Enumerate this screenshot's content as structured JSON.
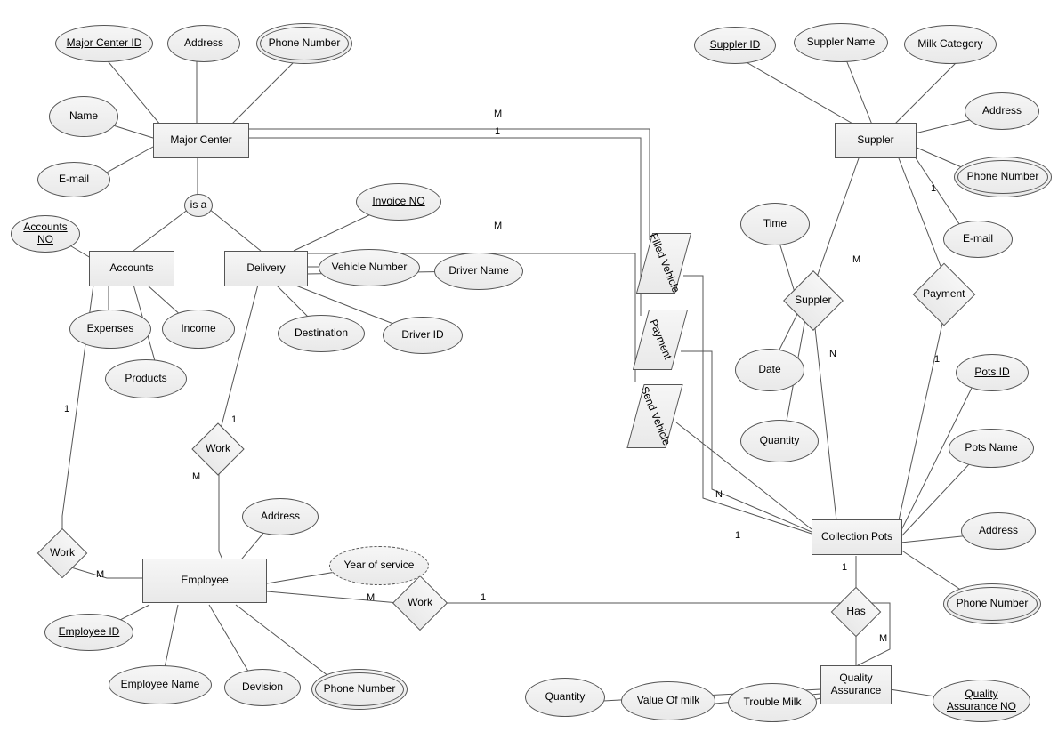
{
  "entities": {
    "major_center": "Major Center",
    "accounts": "Accounts",
    "delivery": "Delivery",
    "employee": "Employee",
    "supplier": "Suppler",
    "collection_pots": "Collection Pots",
    "quality_assurance": "Quality\nAssurance"
  },
  "attributes": {
    "major_center_id": "Major Center ID",
    "mc_address": "Address",
    "mc_phone": "Phone Number",
    "mc_name": "Name",
    "mc_email": "E-mail",
    "accounts_no": "Accounts\nNO",
    "acc_expenses": "Expenses",
    "acc_income": "Income",
    "acc_products": "Products",
    "invoice_no": "Invoice NO",
    "vehicle_number": "Vehicle Number",
    "driver_name": "Driver Name",
    "destination": "Destination",
    "driver_id": "Driver ID",
    "emp_address": "Address",
    "year_of_service": "Year of service",
    "employee_id": "Employee ID",
    "employee_name": "Employee Name",
    "devision": "Devision",
    "emp_phone": "Phone Number",
    "supplier_id": "Suppler ID",
    "supplier_name": "Suppler Name",
    "milk_category": "Milk Category",
    "sup_address": "Address",
    "sup_phone": "Phone Number",
    "sup_email": "E-mail",
    "time": "Time",
    "date": "Date",
    "quantity": "Quantity",
    "pots_id": "Pots ID",
    "pots_name": "Pots Name",
    "cp_address": "Address",
    "cp_phone": "Phone Number",
    "qa_quantity": "Quantity",
    "value_of_milk": "Value Of milk",
    "trouble_milk": "Trouble Milk",
    "qa_no": "Quality\nAssurance NO"
  },
  "relations": {
    "isa": "is a",
    "work1": "Work",
    "work2": "Work",
    "work3": "Work",
    "filled_vehicle": "Filled Vehicle",
    "payment_pgram": "Payment",
    "send_vehicle": "Send Vehicle",
    "supplier_rel": "Suppler",
    "payment_diamond": "Payment",
    "has": "Has"
  },
  "card": {
    "m": "M",
    "n": "N",
    "one": "1"
  }
}
